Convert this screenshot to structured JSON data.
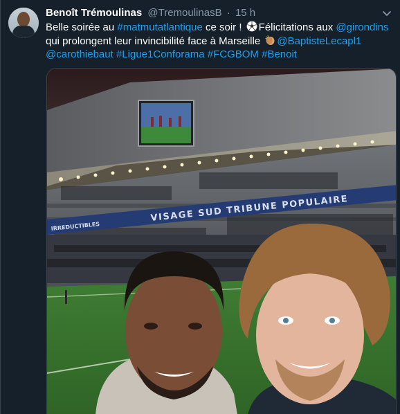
{
  "tweet": {
    "author_name": "Benoît Trémoulinas",
    "author_handle": "@TremoulinasB",
    "separator": "·",
    "timestamp": "15 h",
    "text_parts": {
      "p1": "Belle soirée au ",
      "tag_matmut": "#matmutatlantique",
      "p2": " ce soir ! ",
      "p3": "Félicitations aux ",
      "mention_girondins": "@girondins",
      "p4": " qui prolongent leur invincibilité face à Marseille ",
      "mention_baptiste": "@BaptisteLecapl1",
      "mention_caro": "@carothiebaut",
      "tag_ligue1": "#Ligue1Conforama",
      "tag_fcgbom": "#FCGBOM",
      "tag_benoit": "#Benoit"
    },
    "media": {
      "banner_text": "VISAGE SUD TRIBUNE POPULAIRE",
      "banner_text_left": "IRREDUCTIBLES"
    }
  },
  "colors": {
    "background": "#15202b",
    "link": "#1da1f2",
    "secondary_text": "#8899a6",
    "border": "#38444d"
  },
  "icons": [
    "avatar",
    "chevron-down-icon",
    "soccer-ball-icon",
    "clapping-hands-icon"
  ]
}
